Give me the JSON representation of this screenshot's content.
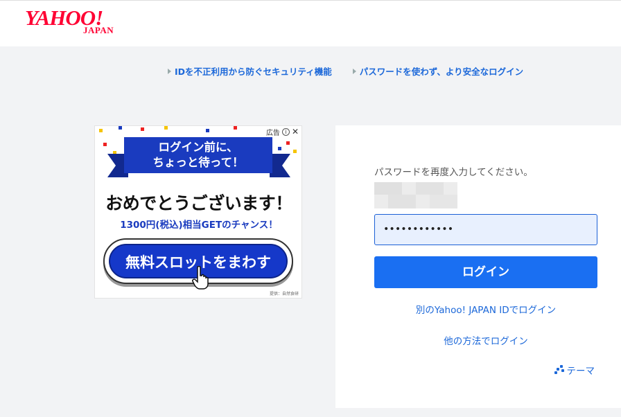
{
  "header": {
    "logo_text": "YAHOO!",
    "logo_sub": "JAPAN"
  },
  "top_links": [
    {
      "label": "IDを不正利用から防ぐセキュリティ機能"
    },
    {
      "label": "パスワードを使わず、より安全なログイン"
    }
  ],
  "ad": {
    "label": "広告",
    "info_icon": "info-icon",
    "close_icon": "close-icon",
    "banner_line1": "ログイン前に、",
    "banner_line2": "ちょっと待って！",
    "headline": "おめでとうございます！",
    "subline": "1300円(税込)相当GETのチャンス！",
    "button_label": "無料スロットをまわす",
    "credit": "提供：自然食研"
  },
  "login": {
    "prompt": "パスワードを再度入力してください。",
    "password_value": "••••••••••••",
    "login_button": "ログイン",
    "alt_login_link": "別のYahoo! JAPAN IDでログイン",
    "other_method_link": "他の方法でログイン",
    "theme_label": "テーマ",
    "theme_icon": "palette-icon"
  },
  "colors": {
    "brand": "#ff0033",
    "link": "#1c68d9",
    "button": "#1a6ff2",
    "input_bg": "#e8f0fe"
  }
}
